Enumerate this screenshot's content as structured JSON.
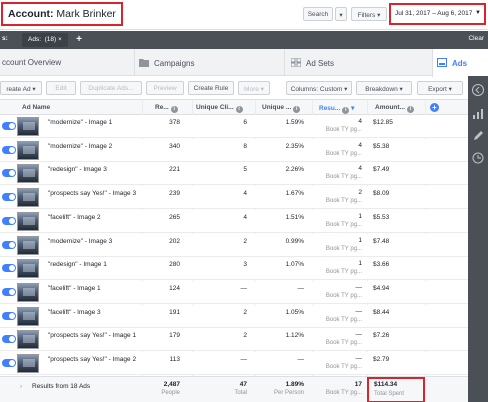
{
  "header": {
    "account_label": "Account:",
    "account_name": "Mark Brinker",
    "search_label": "Search",
    "filters_label": "Filters",
    "date_range": "Jul 31, 2017 – Aug 6, 2017"
  },
  "filterbar": {
    "prefix": "s:",
    "chip_label": "Ads:",
    "chip_value": "(18) ×",
    "add_label": "+",
    "clear_label": "Clear"
  },
  "tabs": [
    {
      "label": "ccount Overview"
    },
    {
      "label": "Campaigns"
    },
    {
      "label": "Ad Sets"
    },
    {
      "label": "Ads"
    }
  ],
  "toolbar": {
    "create_ad": "reate Ad",
    "edit": "Edit",
    "duplicate": "Duplicate Ads...",
    "preview": "Preview",
    "create_rule": "Create Rule",
    "more": "More",
    "columns": "Columns: Custom",
    "breakdown": "Breakdown",
    "export": "Export"
  },
  "columns": {
    "ad_name": "Ad Name",
    "reach": "Re...",
    "unique_clicks": "Unique Cli...",
    "unique_ctr": "Unique ...",
    "results": "Resu...",
    "amount": "Amount..."
  },
  "rows": [
    {
      "name": "\"modernize\" - Image 1",
      "reach": "378",
      "clicks": "6",
      "ctr": "1.59%",
      "results": "4",
      "results_sub": "Book TY pg...",
      "amount": "$12.85"
    },
    {
      "name": "\"modernize\" - Image 2",
      "reach": "340",
      "clicks": "8",
      "ctr": "2.35%",
      "results": "4",
      "results_sub": "Book TY pg...",
      "amount": "$5.38"
    },
    {
      "name": "\"redesign\" - Image 3",
      "reach": "221",
      "clicks": "5",
      "ctr": "2.26%",
      "results": "4",
      "results_sub": "Book TY pg...",
      "amount": "$7.49"
    },
    {
      "name": "\"prospects say Yes!\" - Image 3",
      "reach": "239",
      "clicks": "4",
      "ctr": "1.67%",
      "results": "2",
      "results_sub": "Book TY pg...",
      "amount": "$8.09"
    },
    {
      "name": "\"facelift\" - Image 2",
      "reach": "265",
      "clicks": "4",
      "ctr": "1.51%",
      "results": "1",
      "results_sub": "Book TY pg...",
      "amount": "$5.53"
    },
    {
      "name": "\"modernize\" - Image 3",
      "reach": "202",
      "clicks": "2",
      "ctr": "0.99%",
      "results": "1",
      "results_sub": "Book TY pg...",
      "amount": "$7.48"
    },
    {
      "name": "\"redesign\" - Image 1",
      "reach": "280",
      "clicks": "3",
      "ctr": "1.07%",
      "results": "1",
      "results_sub": "Book TY pg...",
      "amount": "$3.66"
    },
    {
      "name": "\"facelift\" - Image 1",
      "reach": "124",
      "clicks": "—",
      "ctr": "—",
      "results": "—",
      "results_sub": "Book TY pg...",
      "amount": "$4.94"
    },
    {
      "name": "\"facelift\" - Image 3",
      "reach": "191",
      "clicks": "2",
      "ctr": "1.05%",
      "results": "—",
      "results_sub": "Book TY pg...",
      "amount": "$8.44"
    },
    {
      "name": "\"prospects say Yes!\" - Image 1",
      "reach": "179",
      "clicks": "2",
      "ctr": "1.12%",
      "results": "—",
      "results_sub": "Book TY pg...",
      "amount": "$7.26"
    },
    {
      "name": "\"prospects say Yes!\" - Image 2",
      "reach": "113",
      "clicks": "—",
      "ctr": "—",
      "results": "—",
      "results_sub": "Book TY pg...",
      "amount": "$2.79"
    }
  ],
  "totals": {
    "label": "Results from 18 Ads",
    "reach": "2,487",
    "reach_sub": "People",
    "clicks": "47",
    "clicks_sub": "Total",
    "ctr": "1.89%",
    "ctr_sub": "Per Person",
    "results": "17",
    "results_sub": "Book TY pg...",
    "amount": "$114.34",
    "amount_sub": "Total Spent"
  },
  "colors": {
    "accent": "#4080ff",
    "highlight": "#d9232d",
    "rail": "#4b4f56"
  }
}
